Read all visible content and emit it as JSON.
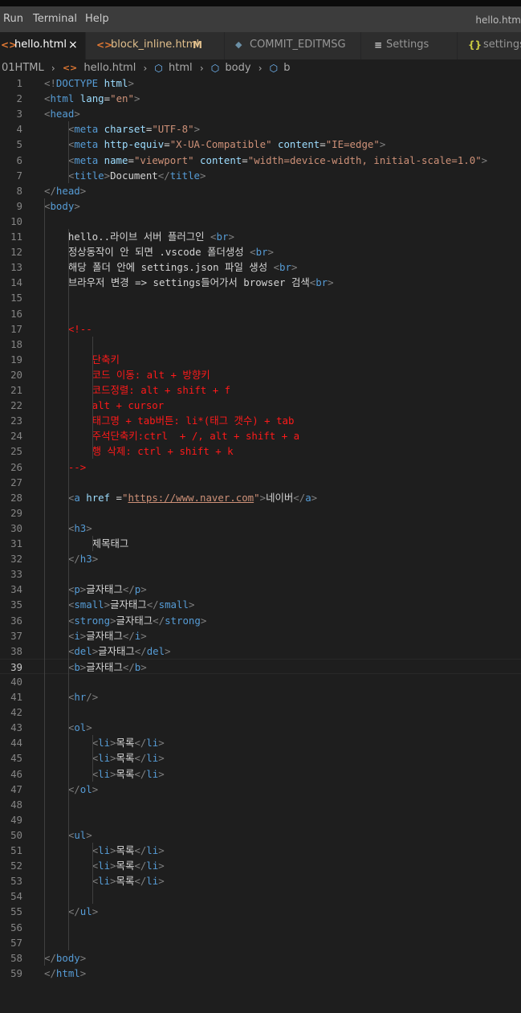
{
  "menu": {
    "items": [
      "Run",
      "Terminal",
      "Help"
    ],
    "window_title": "hello.htm"
  },
  "tabs": [
    {
      "label": "hello.html",
      "icon": "html-file-icon",
      "active": true,
      "close": "×"
    },
    {
      "label": "block_inline.html",
      "icon": "html-file-icon",
      "modified": "M"
    },
    {
      "label": "COMMIT_EDITMSG",
      "icon": "git-commit-icon"
    },
    {
      "label": "Settings",
      "icon": "settings-list-icon"
    },
    {
      "label": "settings.",
      "icon": "json-braces-icon"
    }
  ],
  "breadcrumb": [
    "01HTML",
    "hello.html",
    "html",
    "body",
    "b"
  ],
  "editor": {
    "current_line": 39,
    "lines": [
      "<!DOCTYPE html>",
      "<html lang=\"en\">",
      "<head>",
      "    <meta charset=\"UTF-8\">",
      "    <meta http-equiv=\"X-UA-Compatible\" content=\"IE=edge\">",
      "    <meta name=\"viewport\" content=\"width=device-width, initial-scale=1.0\">",
      "    <title>Document</title>",
      "</head>",
      "<body>",
      "",
      "    hello..라이브 서버 플러그인 <br>",
      "    정상동작이 안 되면 .vscode 폴더생성 <br>",
      "    해당 폴더 안에 settings.json 파일 생성 <br>",
      "    브라우저 변경 => settings들어가서 browser 검색<br>",
      "",
      "",
      "    <!--",
      "",
      "        단축키",
      "        코드 이동: alt + 방향키",
      "        코드정렬: alt + shift + f",
      "        alt + cursor",
      "        태그명 + tab버튼: li*(태그 갯수) + tab",
      "        주석단축키:ctrl  + /, alt + shift + a",
      "        행 삭제: ctrl + shift + k",
      "    -->",
      "",
      "    <a href =\"https://www.naver.com\">네이버</a>",
      "",
      "    <h3>",
      "        제목태그",
      "    </h3>",
      "",
      "    <p>글자태그</p>",
      "    <small>글자태그</small>",
      "    <strong>글자태그</strong>",
      "    <i>글자태그</i>",
      "    <del>글자태그</del>",
      "    <b>글자태그</b>",
      "",
      "    <hr/>",
      "",
      "    <ol>",
      "        <li>목록</li>",
      "        <li>목록</li>",
      "        <li>목록</li>",
      "    </ol>",
      "",
      "",
      "    <ul>",
      "        <li>목록</li>",
      "        <li>목록</li>",
      "        <li>목록</li>",
      "",
      "    </ul>",
      "",
      "",
      "</body>",
      "</html>"
    ]
  },
  "colors": {
    "tag": "#569cd6",
    "bracket": "#808080",
    "attribute": "#9cdcfe",
    "string": "#ce9178",
    "comment": "#ff1a1a",
    "text": "#d4d4d4",
    "background": "#1e1e1e"
  }
}
